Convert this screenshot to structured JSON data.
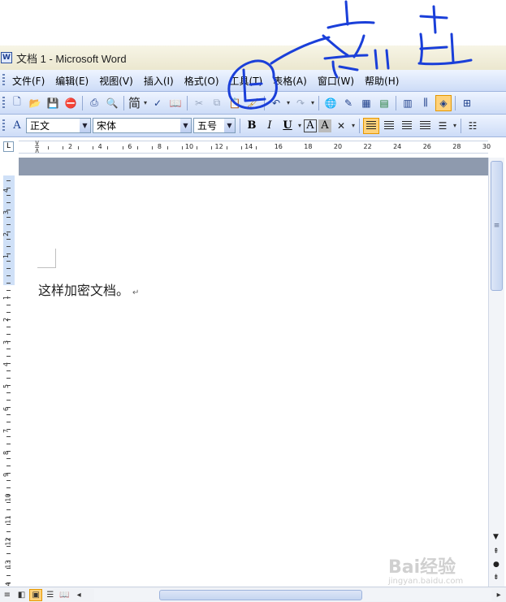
{
  "window": {
    "title": "文档 1 - Microsoft Word",
    "app_icon_letter": "W"
  },
  "menu": [
    {
      "label": "文件(F)"
    },
    {
      "label": "编辑(E)"
    },
    {
      "label": "视图(V)"
    },
    {
      "label": "插入(I)"
    },
    {
      "label": "格式(O)"
    },
    {
      "label": "工具(T)"
    },
    {
      "label": "表格(A)"
    },
    {
      "label": "窗口(W)"
    },
    {
      "label": "帮助(H)"
    }
  ],
  "formatting": {
    "style": "正文",
    "font": "宋体",
    "size": "五号",
    "bold": "B",
    "italic": "I",
    "underline": "U",
    "border_char": "A",
    "shade_char": "A"
  },
  "toolbar": {
    "traditional_char": "简"
  },
  "ruler": {
    "labels": [
      "2",
      "4",
      "6",
      "8",
      "10",
      "12",
      "14",
      "16",
      "18",
      "20",
      "22",
      "24",
      "26",
      "28",
      "30"
    ]
  },
  "vertical_ruler": {
    "upper_labels": [
      "4",
      "3",
      "2",
      "1"
    ],
    "lower_labels": [
      "1",
      "2",
      "3",
      "4",
      "5",
      "6",
      "7",
      "8",
      "9",
      "10",
      "11",
      "12",
      "13",
      "14"
    ]
  },
  "document": {
    "text": "这样加密文档。",
    "para_mark": "↵"
  },
  "watermark": {
    "brand": "Bai经验",
    "url": "jingyan.baidu.com"
  },
  "colors": {
    "ink_annotation": "#1a3fd9",
    "active_button": "#ffd27a"
  }
}
